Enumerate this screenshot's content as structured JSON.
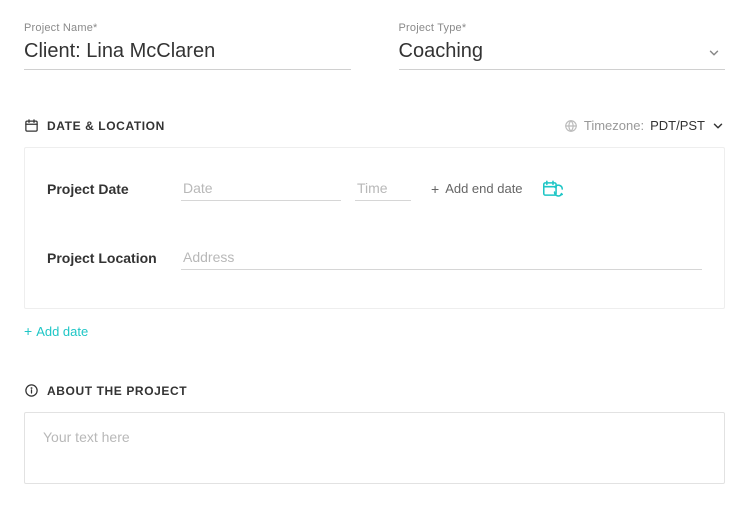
{
  "project_name": {
    "label": "Project Name*",
    "value": "Client: Lina McClaren"
  },
  "project_type": {
    "label": "Project Type*",
    "value": "Coaching"
  },
  "sections": {
    "date_location": {
      "title": "DATE & LOCATION",
      "timezone_label": "Timezone:",
      "timezone_value": "PDT/PST",
      "project_date_label": "Project Date",
      "date_placeholder": "Date",
      "date_value": "",
      "time_placeholder": "Time",
      "time_value": "",
      "add_end_date_label": "Add end date",
      "project_location_label": "Project Location",
      "address_placeholder": "Address",
      "address_value": "",
      "add_date_label": "Add date"
    },
    "about": {
      "title": "ABOUT THE PROJECT",
      "placeholder": "Your text here",
      "value": ""
    }
  }
}
